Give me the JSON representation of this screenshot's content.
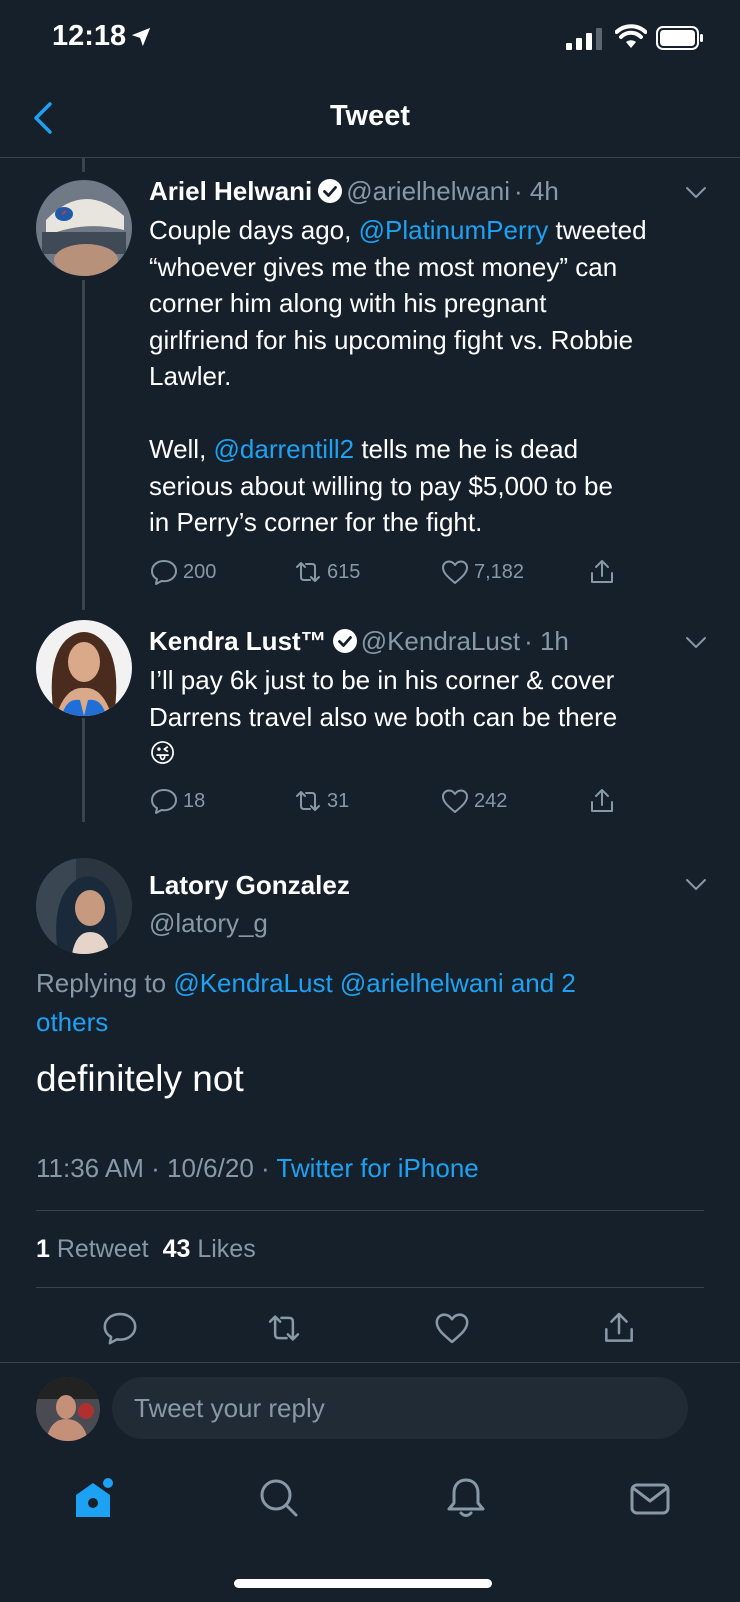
{
  "status_bar": {
    "time": "12:18"
  },
  "header": {
    "title": "Tweet"
  },
  "thread": [
    {
      "name": "Ariel Helwani",
      "handle": "@arielhelwani",
      "time": "· 4h",
      "text_parts": [
        "Couple days ago, ",
        "@PlatinumPerry",
        " tweeted\n“whoever gives me the most money” can\ncorner him along with his pregnant\ngirlfriend for his upcoming fight vs. Robbie\nLawler.\n\nWell, ",
        "@darrentill2",
        " tells me he is dead\nserious about willing to pay $5,000 to be\nin Perry’s corner for the fight."
      ],
      "replies": "200",
      "retweets": "615",
      "likes": "7,182"
    },
    {
      "name": "Kendra Lust™",
      "handle": "@KendraLust",
      "time": "· 1h",
      "text": "I’ll pay 6k just to be in his corner & cover\nDarrens travel also we both can be there\n😜",
      "replies": "18",
      "retweets": "31",
      "likes": "242"
    }
  ],
  "focus": {
    "name": "Latory Gonzalez",
    "handle": "@latory_g",
    "replying_prefix": "Replying to ",
    "replying_to": "@KendraLust @arielhelwani and 2\nothers",
    "text": "definitely not",
    "timestamp": "11:36 AM · 10/6/20 · ",
    "source": "Twitter for iPhone",
    "retweet_count": "1",
    "retweet_label": " Retweet",
    "like_count": "43",
    "like_label": " Likes"
  },
  "reply": {
    "placeholder": "Tweet your reply"
  },
  "colors": {
    "background": "#15202b",
    "accent": "#1da1f2",
    "muted": "#8899a6",
    "divider": "#38444d"
  },
  "icons": [
    "back-chevron-icon",
    "verified-icon",
    "reply-icon",
    "retweet-icon",
    "like-icon",
    "share-icon",
    "home-icon",
    "search-icon",
    "notifications-icon",
    "messages-icon"
  ]
}
